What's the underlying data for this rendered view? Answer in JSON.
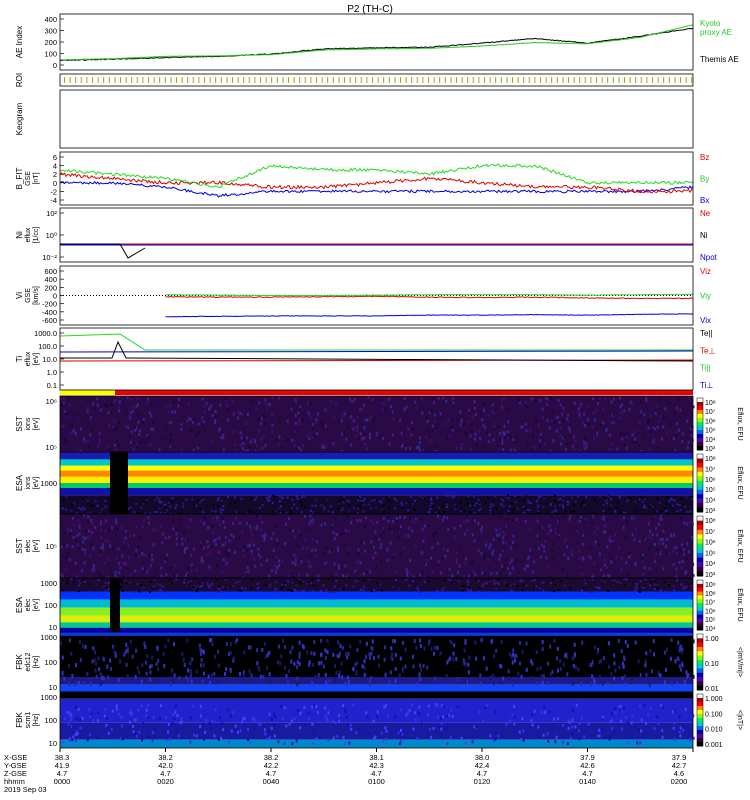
{
  "title": "P2 (TH-C)",
  "date_label": "2019 Sep 03",
  "colors": {
    "red": "#e00000",
    "green": "#22dd22",
    "blue": "#0000dd",
    "black": "#000000",
    "kyoto": "#22cc22"
  },
  "panels": [
    {
      "id": "ae",
      "ylabel": "AE Index",
      "ticks": [
        "400",
        "300",
        "200",
        "100",
        "0"
      ],
      "legend": [
        {
          "text": "Kyoto",
          "color": "#22cc22"
        },
        {
          "text": "proxy AE",
          "color": "#22cc22"
        },
        {
          "text": "Themis AE",
          "color": "#000000"
        }
      ]
    },
    {
      "id": "roi",
      "ylabel": "ROI",
      "ticks": [],
      "legend": []
    },
    {
      "id": "keogram",
      "ylabel": "Keogram",
      "ticks": [],
      "legend": []
    },
    {
      "id": "bfield",
      "ylabel": "B_FIT",
      "ylabel2": "GSE",
      "ylabel3": "[nT]",
      "ticks": [
        "6",
        "4",
        "2",
        "0",
        "-2",
        "-4"
      ],
      "legend": [
        {
          "text": "Bz",
          "color": "#e00000"
        },
        {
          "text": "By",
          "color": "#22cc22"
        },
        {
          "text": "Bx",
          "color": "#0000dd"
        }
      ]
    },
    {
      "id": "ni",
      "ylabel": "Ni",
      "ylabel2": "eflux",
      "ylabel3": "[1/cc]",
      "ticks": [
        "10²",
        "10⁰",
        "10⁻²"
      ],
      "legend": [
        {
          "text": "Ne",
          "color": "#e00000"
        },
        {
          "text": "Ni",
          "color": "#000000"
        },
        {
          "text": "Npot",
          "color": "#0000dd"
        }
      ]
    },
    {
      "id": "vi",
      "ylabel": "Vi",
      "ylabel2": "GSE",
      "ylabel3": "[km/s]",
      "ticks": [
        "600",
        "400",
        "200",
        "0",
        "-200",
        "-400",
        "-600"
      ],
      "legend": [
        {
          "text": "Viz",
          "color": "#e00000"
        },
        {
          "text": "Viy",
          "color": "#22cc22"
        },
        {
          "text": "Vix",
          "color": "#0000dd"
        }
      ]
    },
    {
      "id": "ti",
      "ylabel": "Ti",
      "ylabel2": "eflux",
      "ylabel3": "[eV]",
      "ticks": [
        "1000.0",
        "100.0",
        "10.0",
        "1.0",
        "0.1"
      ],
      "legend": [
        {
          "text": "Te||",
          "color": "#000000"
        },
        {
          "text": "Te⊥",
          "color": "#e00000"
        },
        {
          "text": "Ti||",
          "color": "#22cc22"
        },
        {
          "text": "Ti⊥",
          "color": "#0000dd"
        }
      ]
    },
    {
      "id": "sst_i",
      "ylabel": "SST",
      "ylabel2": "ions",
      "ylabel3": "[eV]",
      "ticks": [
        "10⁶",
        "10⁵"
      ],
      "cbar": [
        "10⁸",
        "10⁷",
        "10⁶",
        "10⁵",
        "10⁴",
        "10³"
      ],
      "cbar_label": "Eflux, EFU"
    },
    {
      "id": "esa_i",
      "ylabel": "ESA",
      "ylabel2": "ions",
      "ylabel3": "[eV]",
      "ticks": [
        "1000"
      ],
      "cbar": [
        "10⁸",
        "10⁷",
        "10⁶",
        "10⁵",
        "10⁴",
        "10³"
      ],
      "cbar_label": "Eflux, EFU"
    },
    {
      "id": "sst_e",
      "ylabel": "SST",
      "ylabel2": "elec",
      "ylabel3": "[eV]",
      "ticks": [
        "10⁵"
      ],
      "cbar": [
        "10⁸",
        "10⁷",
        "10⁶",
        "10⁵",
        "10⁴",
        "10³"
      ],
      "cbar_label": "Eflux, EFU"
    },
    {
      "id": "esa_e",
      "ylabel": "ESA",
      "ylabel2": "elec",
      "ylabel3": "[eV]",
      "ticks": [
        "1000",
        "100",
        "10"
      ],
      "cbar": [
        "10⁹",
        "10⁸",
        "10⁷",
        "10⁶",
        "10⁵",
        "10⁴"
      ],
      "cbar_label": "Eflux, EFU"
    },
    {
      "id": "fbk_e",
      "ylabel": "FBK",
      "ylabel2": "edc12",
      "ylabel3": "[Hz]",
      "ticks": [
        "1000",
        "100",
        "10"
      ],
      "cbar": [
        "1.00",
        "0.10",
        "0.01"
      ],
      "cbar_label": "<|mV/m|>"
    },
    {
      "id": "fbk_b",
      "ylabel": "FBK",
      "ylabel2": "scm1",
      "ylabel3": "[Hz]",
      "ticks": [
        "1000",
        "100",
        "10"
      ],
      "cbar": [
        "1.000",
        "0.100",
        "0.010",
        "0.001"
      ],
      "cbar_label": "<|nT|>"
    }
  ],
  "xaxis": {
    "row_labels": [
      "X-GSE",
      "Y-GSE",
      "Z-GSE",
      "hhmm"
    ],
    "times": [
      "0000",
      "0020",
      "0040",
      "0100",
      "0120",
      "0140",
      "0200"
    ],
    "x_gse": [
      "38.3",
      "38.2",
      "38.2",
      "38.1",
      "38.0",
      "37.9",
      "37.9"
    ],
    "y_gse": [
      "41.9",
      "42.0",
      "42.2",
      "42.3",
      "42.4",
      "42.6",
      "42.7"
    ],
    "z_gse": [
      "4.7",
      "4.7",
      "4.7",
      "4.7",
      "4.7",
      "4.7",
      "4.6"
    ]
  },
  "chart_data": {
    "type": "line",
    "title": "P2 (TH-C)",
    "x": [
      "0000",
      "0010",
      "0020",
      "0030",
      "0040",
      "0050",
      "0100",
      "0110",
      "0120",
      "0130",
      "0140",
      "0150",
      "0200"
    ],
    "xlabel": "hhmm",
    "series": [
      {
        "name": "Kyoto proxy AE",
        "panel": "AE Index",
        "values": [
          45,
          55,
          75,
          80,
          90,
          130,
          140,
          145,
          165,
          195,
          185,
          240,
          350
        ]
      },
      {
        "name": "Themis AE",
        "panel": "AE Index",
        "values": [
          40,
          50,
          65,
          75,
          95,
          140,
          150,
          155,
          190,
          230,
          190,
          250,
          320
        ]
      },
      {
        "name": "Bz",
        "panel": "B_FIT GSE [nT]",
        "values": [
          2,
          1,
          0,
          0,
          -1,
          -1,
          0,
          1,
          0,
          -1,
          -1,
          -2,
          -2
        ]
      },
      {
        "name": "By",
        "panel": "B_FIT GSE [nT]",
        "values": [
          3,
          2,
          1,
          -1,
          4,
          3,
          3,
          2,
          4,
          4,
          0,
          0,
          0
        ]
      },
      {
        "name": "Bx",
        "panel": "B_FIT GSE [nT]",
        "values": [
          0,
          0,
          -1,
          -3,
          -2,
          -2,
          -2,
          -2,
          -2,
          -2,
          -2,
          -2,
          -1
        ]
      },
      {
        "name": "Vix",
        "panel": "Vi GSE [km/s]",
        "values": [
          null,
          null,
          -520,
          -510,
          -500,
          -500,
          -500,
          -480,
          -480,
          -470,
          -480,
          -460,
          -450
        ]
      },
      {
        "name": "Viy",
        "panel": "Vi GSE [km/s]",
        "values": [
          null,
          null,
          20,
          10,
          0,
          0,
          10,
          20,
          20,
          20,
          10,
          20,
          30
        ]
      },
      {
        "name": "Viz",
        "panel": "Vi GSE [km/s]",
        "values": [
          null,
          null,
          -30,
          -40,
          -40,
          -30,
          -20,
          -40,
          -50,
          -40,
          -60,
          -70,
          -70
        ]
      }
    ],
    "ylim": [
      0,
      400
    ]
  }
}
